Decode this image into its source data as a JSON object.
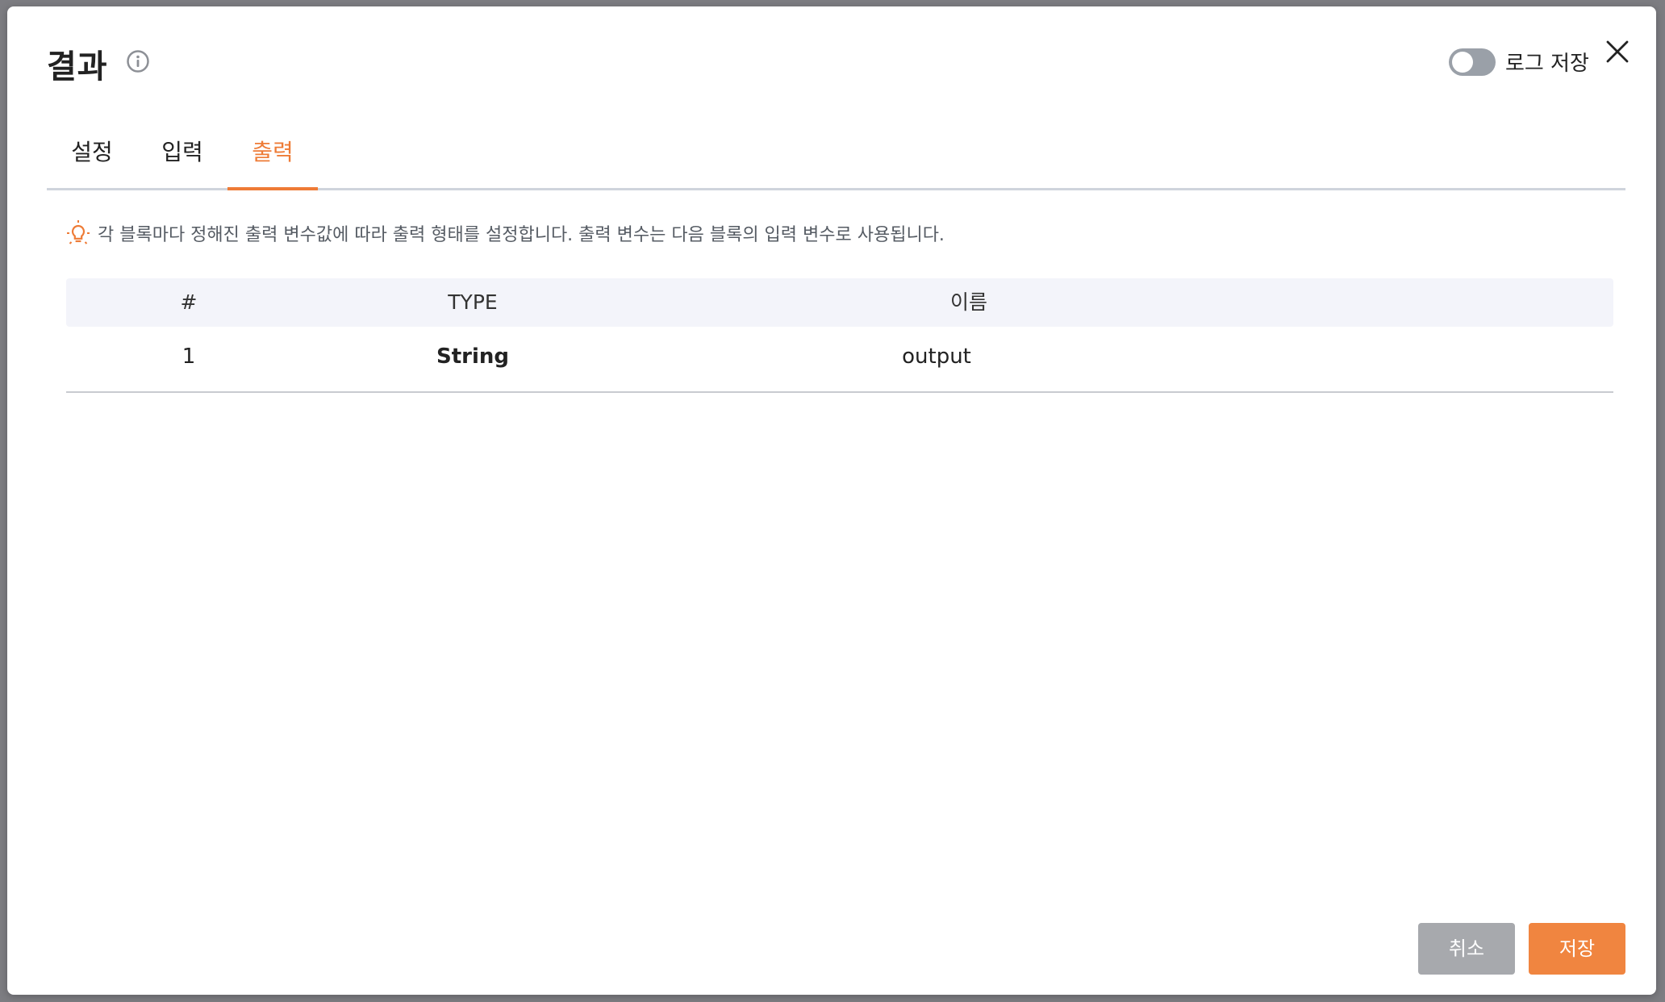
{
  "dialog": {
    "title": "결과",
    "log_toggle": {
      "label": "로그 저장",
      "enabled": false
    }
  },
  "tabs": [
    {
      "label": "설정",
      "active": false
    },
    {
      "label": "입력",
      "active": false
    },
    {
      "label": "출력",
      "active": true
    }
  ],
  "hint": {
    "text": "각 블록마다 정해진 출력 변수값에 따라 출력 형태를 설정합니다. 출력 변수는 다음 블록의 입력 변수로 사용됩니다."
  },
  "table": {
    "headers": [
      "#",
      "TYPE",
      "이름"
    ],
    "rows": [
      {
        "index": "1",
        "type": "String",
        "name": "output"
      }
    ]
  },
  "footer": {
    "cancel_label": "취소",
    "save_label": "저장"
  },
  "colors": {
    "accent": "#ee7b36",
    "cancel_button": "#a7a9ad",
    "save_button": "#f08540",
    "table_header_bg": "#f3f4fa"
  }
}
